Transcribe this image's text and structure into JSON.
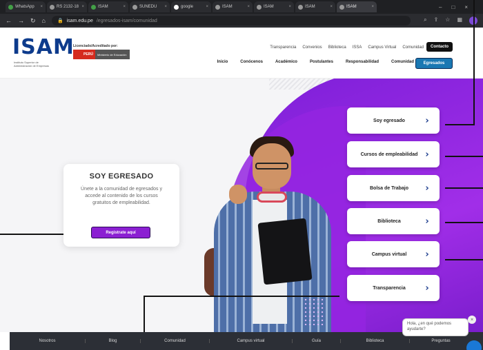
{
  "browser": {
    "tabs": [
      {
        "label": "WhatsApp"
      },
      {
        "label": "RS 2132-18"
      },
      {
        "label": "ISAM"
      },
      {
        "label": "SUNEDU"
      },
      {
        "label": "google"
      },
      {
        "label": "ISAM"
      },
      {
        "label": "ISAM"
      },
      {
        "label": "ISAM"
      },
      {
        "label": "ISAM"
      }
    ],
    "url_host": "isam.edu.pe",
    "url_path": "/egresados-isam/comunidad"
  },
  "header": {
    "logo": "ISAM",
    "logo_sub": "Instituto Superior de Administración de Empresas",
    "licensed_text": "Licenciado/Acreditado por:",
    "minedu_left": "PERÚ",
    "minedu_right": "Ministerio de Educación",
    "top_links": [
      "Transparencia",
      "Convenios",
      "Biblioteca",
      "ISSA",
      "Campus Virtual",
      "Comunidad"
    ],
    "contacto": "Contacto",
    "main_nav": [
      "Inicio",
      "Conócenos",
      "Académico",
      "Postulantes",
      "Responsabilidad",
      "Comunidad"
    ],
    "egresados": "Egresados"
  },
  "hero": {
    "card_title": "SOY EGRESADO",
    "card_text": "Únete a la comunidad de egresados y accede al contenido de los cursos gratuitos de empleabilidad.",
    "card_button": "Registrate aquí"
  },
  "menu": [
    {
      "label": "Soy egresado"
    },
    {
      "label": "Cursos de empleabilidad"
    },
    {
      "label": "Bolsa de Trabajo"
    },
    {
      "label": "Biblioteca"
    },
    {
      "label": "Campus virtual"
    },
    {
      "label": "Transparencia"
    }
  ],
  "footer": [
    "Nosotros",
    "Blog",
    "Comunidad",
    "Campus virtual",
    "Guía",
    "Biblioteca",
    "Preguntas"
  ],
  "chat": {
    "text": "Hola, ¿en qué podemos ayudarte?"
  },
  "colors": {
    "brand_blue": "#0d3b8c",
    "purple": "#8b1fd2",
    "footer_bg": "#2c2f36"
  },
  "icons": [
    "chevron-right-icon",
    "chat-icon",
    "back-icon",
    "forward-icon",
    "reload-icon",
    "home-icon"
  ]
}
